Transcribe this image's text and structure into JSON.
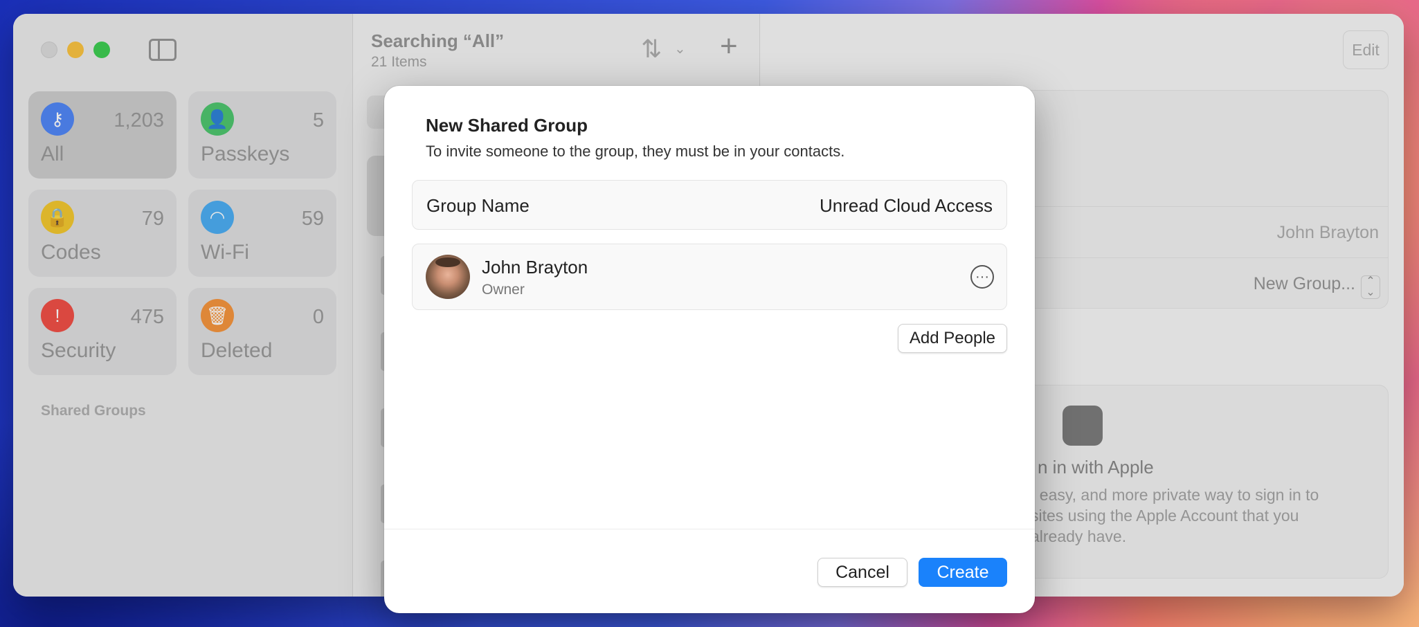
{
  "window": {
    "sidebar": {
      "tiles": [
        {
          "label": "All",
          "count": "1,203",
          "icon": "key-icon",
          "color": "#3f7bf6"
        },
        {
          "label": "Passkeys",
          "count": "5",
          "icon": "person-key-icon",
          "color": "#3cc060"
        },
        {
          "label": "Codes",
          "count": "79",
          "icon": "lock-clock-icon",
          "color": "#f2c21a"
        },
        {
          "label": "Wi-Fi",
          "count": "59",
          "icon": "wifi-icon",
          "color": "#3aa5f2"
        },
        {
          "label": "Security",
          "count": "475",
          "icon": "exclamation-icon",
          "color": "#f03e34"
        },
        {
          "label": "Deleted",
          "count": "0",
          "icon": "trash-icon",
          "color": "#f58a2a"
        }
      ],
      "shared_groups_heading": "Shared Groups"
    },
    "list": {
      "title": "Searching “All”",
      "subtitle": "21 Items"
    },
    "detail": {
      "edit_label": "Edit",
      "owner_value": "John Brayton",
      "group_value": "New Group...",
      "siwa_title": "n in with Apple",
      "siwa_text": ", easy, and more private way to sign in to\nsites using the Apple Account that you\nalready have."
    }
  },
  "modal": {
    "title": "New Shared Group",
    "subtitle": "To invite someone to the group, they must be in your contacts.",
    "group_name_label": "Group Name",
    "group_name_value": "Unread Cloud Access",
    "member": {
      "name": "John Brayton",
      "role": "Owner"
    },
    "add_people_label": "Add People",
    "cancel_label": "Cancel",
    "create_label": "Create",
    "accent_color": "#1a82fb"
  }
}
